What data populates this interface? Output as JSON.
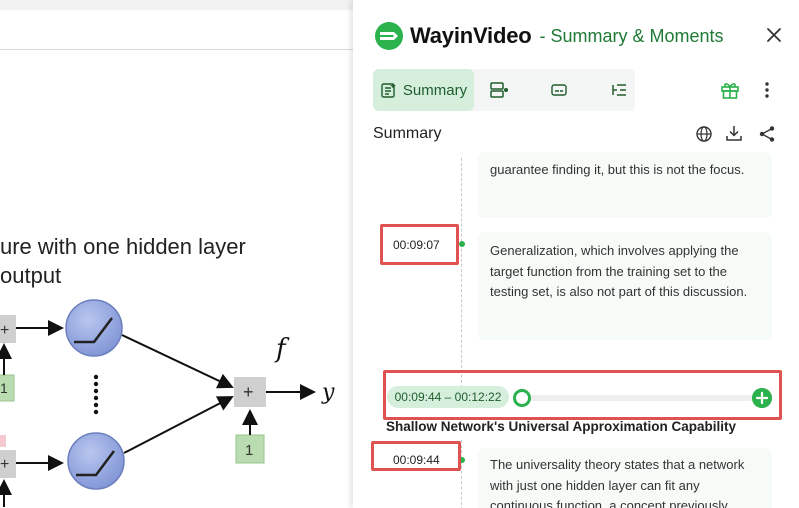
{
  "slide": {
    "title_line1": "ure  with one hidden layer",
    "title_line2": "output",
    "func_label": "f",
    "out_label": "y",
    "bias_label": "1",
    "plus": "+"
  },
  "panel": {
    "brand": "WayinVideo",
    "subtitle": "- Summary & Moments",
    "tabs": [
      {
        "label": "Summary",
        "active": true
      }
    ],
    "section_title": "Summary",
    "items": [
      {
        "text": "guarantee finding it, but this is not the focus."
      },
      {
        "timestamp": "00:09:07",
        "text": "Generalization, which involves applying the target function from the training set to the testing set, is also not part of this discussion."
      }
    ],
    "chapter": {
      "range": "00:09:44 – 00:12:22",
      "title": "Shallow Network's Universal Approximation Capability",
      "items": [
        {
          "timestamp": "00:09:44",
          "text": "The universality theory states that a network with just one hidden layer can fit any continuous function, a concept previously"
        }
      ]
    },
    "colors": {
      "accent": "#2bb24c",
      "highlight": "#e05252",
      "tab_active_bg": "#d6efdc"
    }
  }
}
